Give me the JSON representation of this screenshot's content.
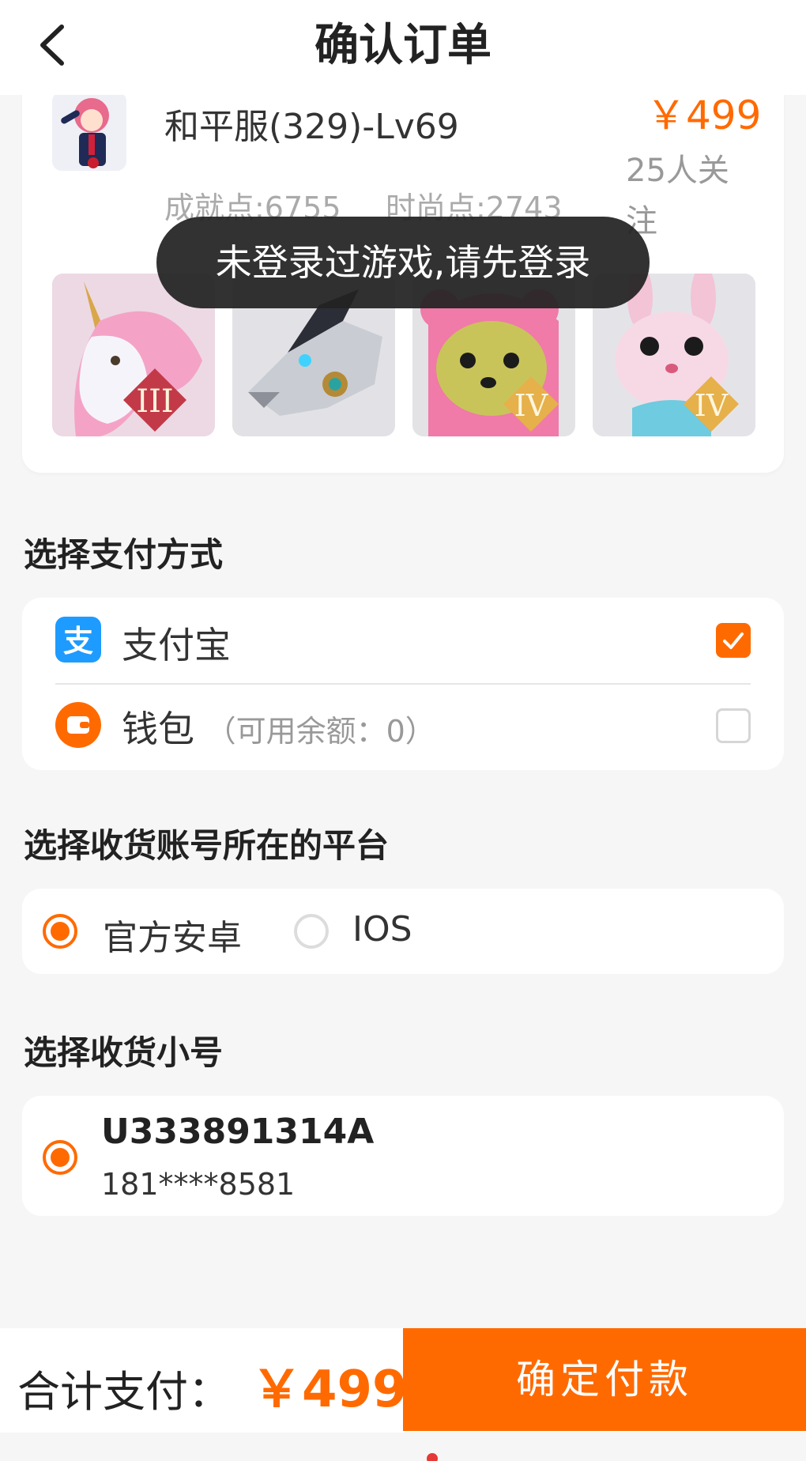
{
  "header": {
    "title": "确认订单",
    "back_icon": "chevron-left-icon"
  },
  "product": {
    "name": "和平服(329)-Lv69",
    "price": "￥499",
    "followers": "25人关注",
    "achievement": "成就点:6755",
    "fashion": "时尚点:2743",
    "items": [
      {
        "badge": "III",
        "icon": "unicorn-mount"
      },
      {
        "badge": "",
        "icon": "mech-dragon-mount"
      },
      {
        "badge": "IV",
        "icon": "pink-bear-pet"
      },
      {
        "badge": "IV",
        "icon": "bunny-pet"
      }
    ]
  },
  "toast": {
    "text": "未登录过游戏,请先登录"
  },
  "payment": {
    "section_title": "选择支付方式",
    "options": [
      {
        "label": "支付宝",
        "sub": "",
        "selected": true,
        "icon": "alipay-icon",
        "color": "#1E9BFF"
      },
      {
        "label": "钱包",
        "sub": "（可用余额：0）",
        "selected": false,
        "icon": "wallet-icon",
        "color": "#FF6A00"
      }
    ]
  },
  "platform": {
    "section_title": "选择收货账号所在的平台",
    "options": [
      {
        "label": "官方安卓",
        "selected": true
      },
      {
        "label": "IOS",
        "selected": false
      }
    ]
  },
  "account": {
    "section_title": "选择收货小号",
    "id": "U333891314A",
    "phone": "181****8581",
    "selected": true
  },
  "footer": {
    "total_label": "合计支付：",
    "total_price": "￥499",
    "pay_button": "确定付款"
  },
  "colors": {
    "accent": "#FF6A00",
    "alipay": "#1E9BFF"
  }
}
